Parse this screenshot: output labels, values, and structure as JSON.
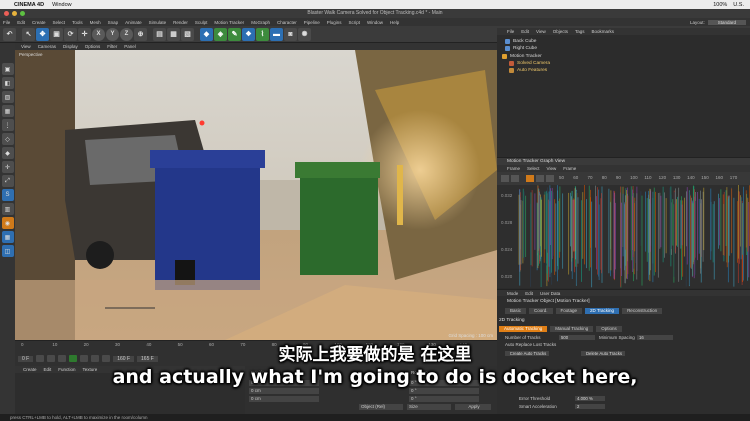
{
  "macbar": {
    "app": "CINEMA 4D",
    "menus": [
      "Window"
    ],
    "status_percent": "100%",
    "time": "U.S."
  },
  "window": {
    "title": "Blaster Walk Camera Solved for Object Tracking.c4d * - Main"
  },
  "app_menu": {
    "items": [
      "File",
      "Edit",
      "Create",
      "Select",
      "Tools",
      "Mesh",
      "Snap",
      "Animate",
      "Simulate",
      "Render",
      "Sculpt",
      "Motion Tracker",
      "MoGraph",
      "Character",
      "Pipeline",
      "Plugins",
      "Script",
      "Window",
      "Help"
    ],
    "layout_label": "Layout:",
    "layout_value": "Standard"
  },
  "toolbar": {
    "axis": [
      "X",
      "Y",
      "Z"
    ]
  },
  "viewport": {
    "menu": [
      "View",
      "Cameras",
      "Display",
      "Options",
      "Filter",
      "Panel"
    ],
    "camera_label": "Perspective",
    "grid_info": "Grid Spacing : 100 cm"
  },
  "timeline": {
    "ticks": [
      "0",
      "10",
      "20",
      "30",
      "40",
      "50",
      "60",
      "70",
      "80",
      "90",
      "100",
      "110",
      "120",
      "130",
      "140"
    ],
    "frame_start": "0 F",
    "frame_end": "160 F",
    "frame_total": "165 F"
  },
  "materials": {
    "menu": [
      "Create",
      "Edit",
      "Function",
      "Texture"
    ]
  },
  "coords": {
    "headers": [
      "Position",
      "Size",
      "Rotation"
    ],
    "x": "0 cm",
    "y": "0 cm",
    "z": "0 cm",
    "h": "0 °",
    "p": "0 °",
    "b": "0 °",
    "mode": "Object (Rel)",
    "size_mode": "Size",
    "apply": "Apply"
  },
  "status_bar": {
    "text": "press CTRL+LMB to hold, ALT+LMB to maximize in the room/column"
  },
  "object_manager": {
    "menu": [
      "File",
      "Edit",
      "View",
      "Objects",
      "Tags",
      "Bookmarks"
    ],
    "objects": [
      {
        "name": "Back Cube",
        "color": "#5a8ed0"
      },
      {
        "name": "Right Cube",
        "color": "#5a8ed0"
      },
      {
        "name": "Motion Tracker",
        "color": "#e0a030"
      },
      {
        "name": "Solved Camera",
        "color": "#c25b3a"
      },
      {
        "name": "Auto Features",
        "color": "#c28a3a"
      }
    ]
  },
  "graph_view": {
    "title": "Motion Tracker Graph View",
    "menu": [
      "Frame",
      "Select",
      "View",
      "Frame"
    ],
    "ruler": [
      "50",
      "60",
      "70",
      "80",
      "90",
      "100",
      "110",
      "120",
      "130",
      "140",
      "150",
      "160",
      "170"
    ],
    "yticks": [
      "0.032",
      "0.028",
      "0.024",
      "0.020"
    ]
  },
  "attributes": {
    "menu": [
      "Mode",
      "Edit",
      "User Data"
    ],
    "header": "Motion Tracker Object [Motion Tracker]",
    "tabs": [
      "Basic",
      "Coord.",
      "Footage",
      "2D Tracking",
      "Reconstruction"
    ],
    "active_tab": "2D Tracking",
    "section": "2D Tracking",
    "subtabs": [
      "Automatic Tracking",
      "Manual Tracking",
      "Options"
    ],
    "active_subtab": "Automatic Tracking",
    "params": [
      {
        "label": "Number of Tracks",
        "value": "500"
      },
      {
        "label": "Minimum Spacing",
        "value": "16"
      },
      {
        "label": "Auto Replace Lost Tracks",
        "value": ""
      },
      {
        "label": "Create Auto Tracks",
        "value": ""
      },
      {
        "label": "Delete Auto Tracks",
        "value": ""
      },
      {
        "label": "Error Threshold",
        "value": "4.000 %"
      },
      {
        "label": "Smart Acceleration",
        "value": "2"
      }
    ]
  },
  "subtitles": {
    "cn": "实际上我要做的是 在这里",
    "en": "and actually what I'm going to do is docket here,"
  }
}
